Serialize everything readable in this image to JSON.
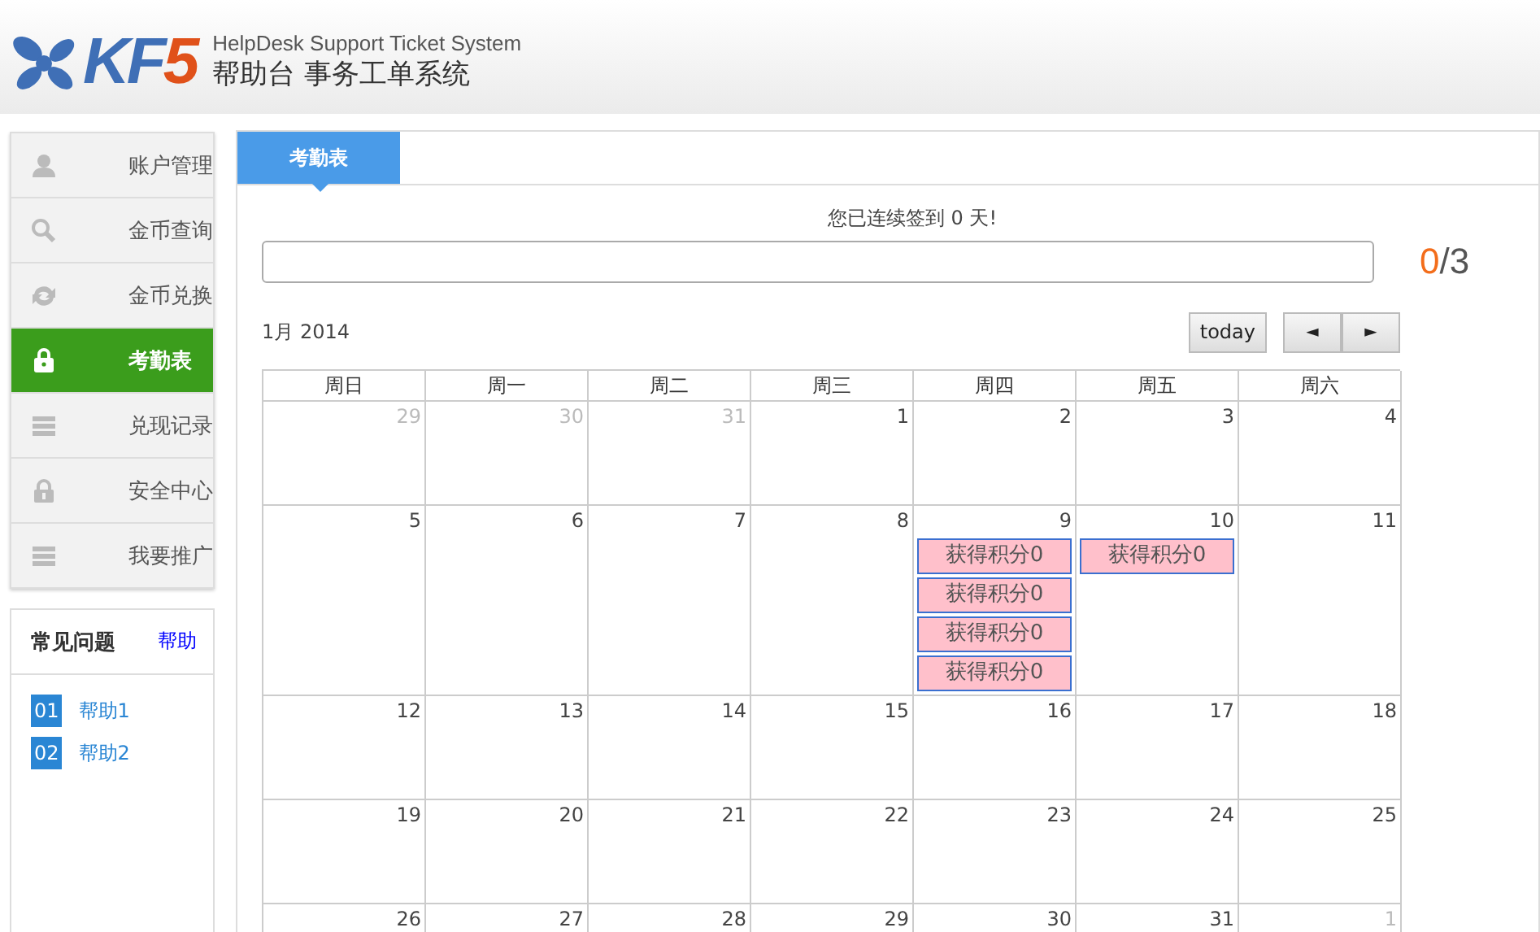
{
  "header": {
    "logo_main": "KF",
    "logo_accent": "5",
    "tagline_en": "HelpDesk  Support Ticket System",
    "tagline_cn": "帮助台  事务工单系统"
  },
  "sidebar": {
    "items": [
      {
        "label": "账户管理",
        "kind": "person",
        "selected": false
      },
      {
        "label": "金币查询",
        "kind": "search",
        "selected": false
      },
      {
        "label": "金币兑换",
        "kind": "refresh",
        "selected": false
      },
      {
        "label": "考勤表",
        "kind": "bag",
        "selected": true
      },
      {
        "label": "兑现记录",
        "kind": "stack",
        "selected": false
      },
      {
        "label": "安全中心",
        "kind": "padlock",
        "selected": false
      },
      {
        "label": "我要推广",
        "kind": "stack",
        "selected": false
      }
    ]
  },
  "faq": {
    "title": "常见问题",
    "link": "帮助",
    "items": [
      {
        "number": "01",
        "label": "帮助1"
      },
      {
        "number": "02",
        "label": "帮助2"
      }
    ]
  },
  "tabs": [
    {
      "label": "考勤表",
      "selected": true
    }
  ],
  "checkin": {
    "message": "您已连续签到 0 天!",
    "level": 0,
    "count": "0",
    "total": "/3"
  },
  "calendar": {
    "month": "1月 2014",
    "today_button": "today",
    "prev_button": "◄",
    "next_button": "►",
    "weekdays": [
      "周日",
      "周一",
      "周二",
      "周三",
      "周四",
      "周五",
      "周六"
    ],
    "weeks": [
      [
        {
          "day": "29",
          "other_month": true
        },
        {
          "day": "30",
          "other_month": true
        },
        {
          "day": "31",
          "other_month": true
        },
        {
          "day": "1",
          "other_month": false
        },
        {
          "day": "2",
          "other_month": false
        },
        {
          "day": "3",
          "other_month": false
        },
        {
          "day": "4",
          "other_month": false
        }
      ],
      [
        {
          "day": "5",
          "other_month": false
        },
        {
          "day": "6",
          "other_month": false
        },
        {
          "day": "7",
          "other_month": false
        },
        {
          "day": "8",
          "other_month": false
        },
        {
          "day": "9",
          "other_month": false,
          "events": [
            "获得积分0",
            "获得积分0",
            "获得积分0",
            "获得积分0"
          ]
        },
        {
          "day": "10",
          "other_month": false,
          "events": [
            "获得积分0"
          ]
        },
        {
          "day": "11",
          "other_month": false
        }
      ],
      [
        {
          "day": "12",
          "other_month": false
        },
        {
          "day": "13",
          "other_month": false
        },
        {
          "day": "14",
          "other_month": false
        },
        {
          "day": "15",
          "other_month": false
        },
        {
          "day": "16",
          "other_month": false
        },
        {
          "day": "17",
          "other_month": false
        },
        {
          "day": "18",
          "other_month": false
        }
      ],
      [
        {
          "day": "19",
          "other_month": false
        },
        {
          "day": "20",
          "other_month": false
        },
        {
          "day": "21",
          "other_month": false
        },
        {
          "day": "22",
          "other_month": false
        },
        {
          "day": "23",
          "other_month": false
        },
        {
          "day": "24",
          "other_month": false
        },
        {
          "day": "25",
          "other_month": false
        }
      ],
      [
        {
          "day": "26",
          "other_month": false
        },
        {
          "day": "27",
          "other_month": false
        },
        {
          "day": "28",
          "other_month": false
        },
        {
          "day": "29",
          "other_month": false
        },
        {
          "day": "30",
          "other_month": false
        },
        {
          "day": "31",
          "other_month": false
        },
        {
          "day": "1",
          "other_month": true
        }
      ]
    ]
  }
}
